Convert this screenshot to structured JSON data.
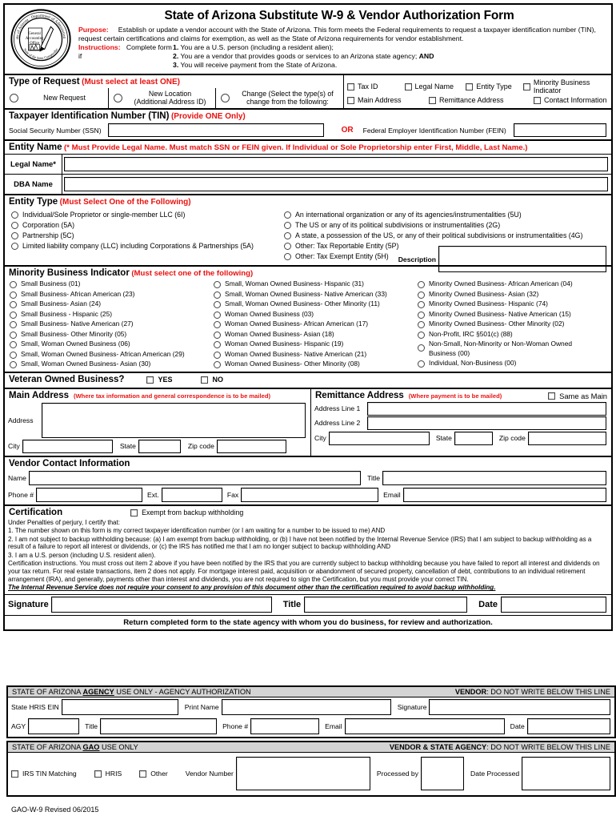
{
  "header": {
    "title": "State of Arizona Substitute W-9 & Vendor Authorization Form",
    "seal_outer_top": "State of Arizona",
    "seal_outer_top2": "Department of Administration",
    "seal_center": "General Accounting Office",
    "seal_outer_bottom": "State of the State Comptroller",
    "purpose_label": "Purpose:",
    "purpose_text": "Establish or update a vendor account with the State of Arizona.  This form meets the Federal requirements to request a taxpayer identification number (TIN), request certain certifications and claims for exemption, as well as the State of Arizona requirements  for vendor establishment.",
    "instructions_label": "Instructions:",
    "instructions_text": "Complete form if",
    "instruction_items": [
      {
        "num": "1.",
        "text": "You are a U.S. person (including a resident alien);"
      },
      {
        "num": "2.",
        "text": "You are a vendor that provides goods or services to an Arizona state agency;",
        "bold_tail": "AND"
      },
      {
        "num": "3.",
        "text": "You will receive payment from the State of Arizona."
      }
    ]
  },
  "type_of_request": {
    "heading": "Type of Request",
    "hint": "(Must select at least ONE)",
    "options": [
      {
        "label_line1": "New Request",
        "label_line2": ""
      },
      {
        "label_line1": "New Location",
        "label_line2": "(Additional Address ID)"
      },
      {
        "label_line1": "Change (Select the type(s) of",
        "label_line2": "change from the following:"
      }
    ],
    "change_row1": [
      "Tax ID",
      "Legal Name",
      "Entity Type",
      "Minority Business Indicator"
    ],
    "change_row2": [
      "Main Address",
      "Remittance Address",
      "Contact Information"
    ]
  },
  "tin": {
    "heading": "Taxpayer Identification Number (TIN)",
    "hint": "(Provide ONE Only)",
    "ssn_label": "Social Security Number (SSN)",
    "ssn_value": "",
    "or": "OR",
    "fein_label": "Federal Employer Identification Number (FEIN)",
    "fein_value": ""
  },
  "entity_name": {
    "heading": "Entity Name",
    "hint": "(* Must Provide Legal Name.  Must match SSN or FEIN given.  If Individual or Sole Proprietorship enter First, Middle, Last Name.)",
    "legal_name_label": "Legal Name*",
    "legal_name_value": "",
    "dba_label": "DBA Name",
    "dba_value": ""
  },
  "entity_type": {
    "heading": "Entity Type",
    "hint": "(Must Select One of the Following)",
    "col1": [
      "Individual/Sole Proprietor  or single-member LLC (6I)",
      "Corporation (5A)",
      "Partnership (5C)",
      "Limited liability company (LLC) including Corporations &  Partnerships (5A)"
    ],
    "col2": [
      "An international organization or any of its agencies/instrumentalities  (5U)",
      "The US or any of its political subdivisions or instrumentalities     (2G)",
      "A state, a possession of the US, or any of their political subdivisions or instrumentalities  (4G)",
      "Other: Tax Reportable Entity   (5P)",
      "Other:  Tax Exempt Entity   (5H)"
    ],
    "description_label": "Description",
    "description_value": ""
  },
  "minority": {
    "heading": "Minority Business Indicator",
    "hint": "(Must select one of the following)",
    "col1": [
      "Small Business    (01)",
      "Small Business- African American    (23)",
      "Small Business- Asian    (24)",
      "Small Business - Hispanic    (25)",
      "Small Business- Native American    (27)",
      "Small Business- Other Minority    (05)",
      "Small, Woman Owned Business    (06)",
      "Small, Woman Owned Business- African American    (29)",
      "Small, Woman Owned Business- Asian    (30)"
    ],
    "col2": [
      "Small, Woman Owned Business- Hispanic    (31)",
      "Small, Woman Owned Business- Native American    (33)",
      "Small, Woman Owned Business- Other Minority    (11)",
      "Woman Owned Business    (03)",
      "Woman Owned Business- African American    (17)",
      "Woman Owned Business- Asian    (18)",
      "Woman Owned Business- Hispanic    (19)",
      "Woman Owned Business- Native American    (21)",
      "Woman Owned Business- Other Minority    (08)"
    ],
    "col3": [
      "Minority Owned Business- African American    (04)",
      "Minority Owned Business- Asian    (32)",
      "Minority Owned Business- Hispanic    (74)",
      "Minority Owned Business- Native American    (15)",
      "Minority Owned Business- Other Minority    (02)",
      "Non-Profit, IRC  §501(c)    (88)",
      "Non-Small, Non-Minority or Non-Woman Owned Business (00)",
      "Individual, Non-Business    (00)"
    ]
  },
  "veteran": {
    "heading": "Veteran Owned Business?",
    "yes": "YES",
    "no": "NO"
  },
  "main_address": {
    "heading": "Main Address",
    "hint": "(Where tax information and general correspondence  is to be mailed)",
    "address_label": "Address",
    "address_value": "",
    "city_label": "City",
    "city_value": "",
    "state_label": "State",
    "state_value": "",
    "zip_label": "Zip code",
    "zip_value": ""
  },
  "remittance_address": {
    "heading": "Remittance Address",
    "hint": "(Where payment is to be mailed)",
    "same_as_main": "Same as Main",
    "line1_label": "Address Line 1",
    "line1_value": "",
    "line2_label": "Address Line 2",
    "line2_value": "",
    "city_label": "City",
    "city_value": "",
    "state_label": "State",
    "state_value": "",
    "zip_label": "Zip code",
    "zip_value": ""
  },
  "vendor_contact": {
    "heading": "Vendor Contact Information",
    "name_label": "Name",
    "name_value": "",
    "title_label": "Title",
    "title_value": "",
    "phone_label": "Phone #",
    "phone_value": "",
    "ext_label": "Ext.",
    "ext_value": "",
    "fax_label": "Fax",
    "fax_value": "",
    "email_label": "Email",
    "email_value": ""
  },
  "certification": {
    "heading": "Certification",
    "exempt_label": "Exempt from backup withholding",
    "intro": "Under Penalties of perjury, I certify that:",
    "items": [
      "1. The number shown on this form is my correct taxpayer identification number (or I am waiting for a number to be issued to me) AND",
      "2. I am not subject to backup withholding because: (a) I am exempt from backup withholding, or (b) I have not been notified by the Internal Revenue Service (IRS) that I am subject to backup withholding as a result of a failure to report all interest or dividends, or (c) the IRS has notified me that I am no longer subject to backup withholding AND",
      "3. I am a U.S. person (including U.S. resident alien)."
    ],
    "instructions": "Certification instructions. You must cross out item 2 above if you have been notified by the IRS that you are currently subject to backup withholding because you have failed to report all interest and dividends on your tax return. For real estate transactions, item 2 does not apply. For mortgage interest paid, acquisition or abandonment of secured property, cancellation of debt, contributions to an individual retirement arrangement (IRA), and generally, payments other than interest and dividends, you are not required to sign the Certification, but you must provide your correct TIN.",
    "irs_notice": "The Internal Revenue Service does not require your consent to any provision of this document other than the certification required to avoid backup withholding.",
    "signature_label": "Signature",
    "signature_value": "",
    "title_label": "Title",
    "title_value": "",
    "date_label": "Date",
    "date_value": "",
    "return_notice": "Return completed form to the state agency with whom you do business, for review and authorization."
  },
  "agency_block": {
    "bar_left_prefix": "STATE OF ARIZONA ",
    "bar_left_bold": "AGENCY",
    "bar_left_suffix": " USE ONLY - AGENCY AUTHORIZATION",
    "bar_right_bold": "VENDOR",
    "bar_right_suffix": ": DO NOT WRITE BELOW THIS LINE",
    "hris_ein_label": "State HRIS EIN",
    "hris_ein_value": "",
    "print_name_label": "Print Name",
    "print_name_value": "",
    "signature_label": "Signature",
    "signature_value": "",
    "agy_label": "AGY",
    "agy_value": "",
    "title_label": "Title",
    "title_value": "",
    "phone_label": "Phone #",
    "phone_value": "",
    "email_label": "Email",
    "email_value": "",
    "date_label": "Date",
    "date_value": ""
  },
  "gao_block": {
    "bar_left_prefix": "STATE OF ARIZONA ",
    "bar_left_bold": "GAO",
    "bar_left_suffix": " USE ONLY",
    "bar_right_bold": "VENDOR & STATE AGENCY",
    "bar_right_suffix": ": DO NOT WRITE BELOW THIS LINE",
    "irs_tin_matching": "IRS TIN Matching",
    "hris": "HRIS",
    "other": "Other",
    "vendor_number_label": "Vendor Number",
    "vendor_number_value": "",
    "processed_by_label": "Processed by",
    "processed_by_value": "",
    "date_processed_label": "Date Processed",
    "date_processed_value": ""
  },
  "footer": {
    "text": "GAO-W-9  Revised 06/2015"
  },
  "colors": {
    "red_accent": "#e8110f",
    "bar_gray": "#d4d4d4"
  }
}
